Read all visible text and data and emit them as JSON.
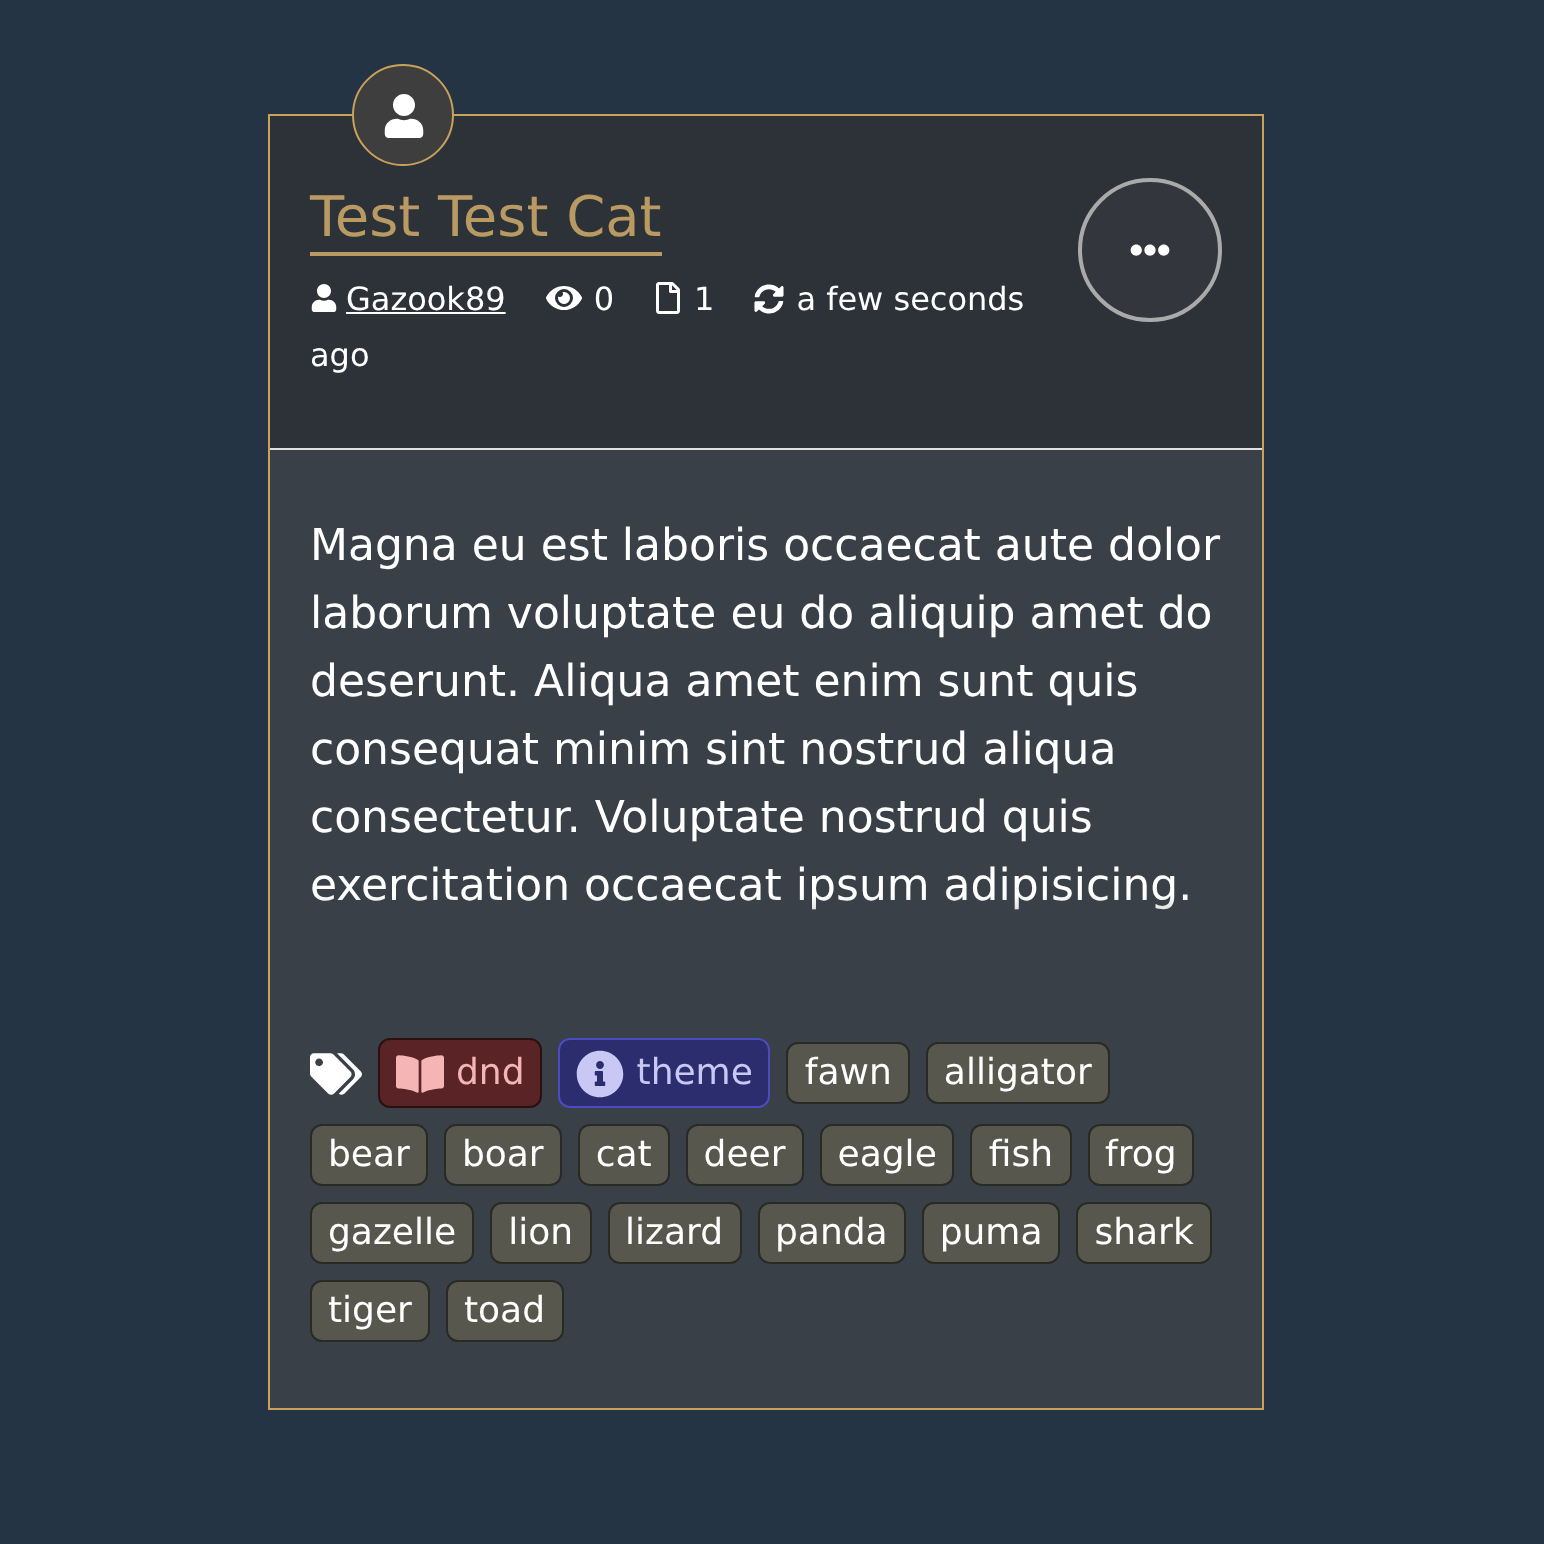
{
  "card": {
    "title": "Test Test Cat",
    "meta": {
      "author": "Gazook89",
      "views": "0",
      "pages": "1",
      "updated": "a few seconds ago"
    },
    "description": "Magna eu est laboris occaecat aute dolor laborum voluptate eu do aliquip amet do deserunt. Aliqua amet enim sunt quis consequat minim sint nostrud aliqua consectetur. Voluptate nostrud quis exercitation occaecat ipsum adipisicing.",
    "tags": [
      {
        "label": "dnd",
        "kind": "book",
        "color": "#5a2326"
      },
      {
        "label": "theme",
        "kind": "info",
        "color": "#2c2d6e"
      },
      {
        "label": "fawn",
        "kind": "plain"
      },
      {
        "label": "alligator",
        "kind": "plain"
      },
      {
        "label": "bear",
        "kind": "plain"
      },
      {
        "label": "boar",
        "kind": "plain"
      },
      {
        "label": "cat",
        "kind": "plain"
      },
      {
        "label": "deer",
        "kind": "plain"
      },
      {
        "label": "eagle",
        "kind": "plain"
      },
      {
        "label": "fish",
        "kind": "plain"
      },
      {
        "label": "frog",
        "kind": "plain"
      },
      {
        "label": "gazelle",
        "kind": "plain"
      },
      {
        "label": "lion",
        "kind": "plain"
      },
      {
        "label": "lizard",
        "kind": "plain"
      },
      {
        "label": "panda",
        "kind": "plain"
      },
      {
        "label": "puma",
        "kind": "plain"
      },
      {
        "label": "shark",
        "kind": "plain"
      },
      {
        "label": "tiger",
        "kind": "plain"
      },
      {
        "label": "toad",
        "kind": "plain"
      }
    ]
  }
}
